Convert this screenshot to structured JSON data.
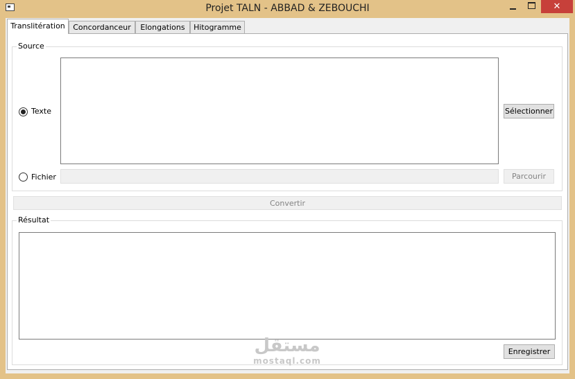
{
  "window": {
    "title": "Projet TALN - ABBAD & ZEBOUCHI",
    "close_glyph": "✕"
  },
  "tabs": [
    {
      "label": "Translitération",
      "active": true
    },
    {
      "label": "Concordanceur",
      "active": false
    },
    {
      "label": "Elongations",
      "active": false
    },
    {
      "label": "Hitogramme",
      "active": false
    }
  ],
  "source": {
    "group_title": "Source",
    "texte_label": "Texte",
    "texte_selected": true,
    "texte_value": "",
    "fichier_label": "Fichier",
    "fichier_selected": false,
    "fichier_value": "",
    "select_button": "Sélectionner",
    "browse_button": "Parcourir"
  },
  "convert_button": "Convertir",
  "result": {
    "group_title": "Résultat",
    "value": "",
    "save_button": "Enregistrer"
  },
  "watermark": {
    "logo_text": "مستقل",
    "site": "mostaql.com"
  }
}
